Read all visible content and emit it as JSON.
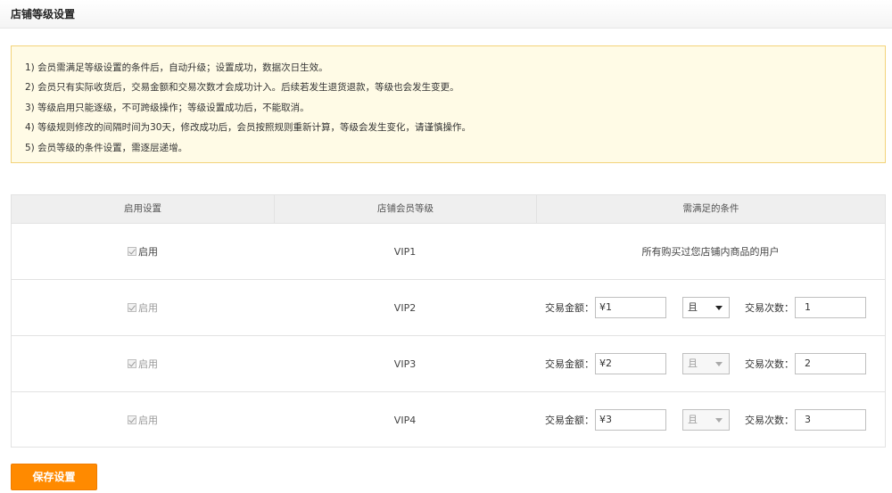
{
  "header": {
    "title": "店铺等级设置"
  },
  "notice": {
    "lines": [
      "1) 会员需满足等级设置的条件后，自动升级；设置成功，数据次日生效。",
      "2) 会员只有实际收货后，交易金额和交易次数才会成功计入。后续若发生退货退款，等级也会发生变更。",
      "3) 等级启用只能逐级，不可跨级操作；等级设置成功后，不能取消。",
      "4) 等级规则修改的间隔时间为30天，修改成功后，会员按照规则重新计算，等级会发生变化，请谨慎操作。",
      "5) 会员等级的条件设置，需逐层递增。"
    ]
  },
  "table": {
    "headers": [
      "启用设置",
      "店铺会员等级",
      "需满足的条件"
    ],
    "rows": [
      {
        "enable_label": "启用",
        "checked": true,
        "level": "VIP1",
        "condition_text": "所有购买过您店铺内商品的用户"
      },
      {
        "enable_label": "启用",
        "checked": true,
        "level": "VIP2",
        "amount_label": "交易金额：",
        "amount": "¥1",
        "logic": "且",
        "count_label": "交易次数：",
        "count": "1"
      },
      {
        "enable_label": "启用",
        "checked": true,
        "level": "VIP3",
        "amount_label": "交易金额：",
        "amount": "¥2",
        "logic": "且",
        "count_label": "交易次数：",
        "count": "2"
      },
      {
        "enable_label": "启用",
        "checked": true,
        "level": "VIP4",
        "amount_label": "交易金额：",
        "amount": "¥3",
        "logic": "且",
        "count_label": "交易次数：",
        "count": "3"
      }
    ]
  },
  "actions": {
    "save_label": "保存设置"
  },
  "colors": {
    "accent": "#ff8a00",
    "notice_bg": "#fffbe6",
    "notice_border": "#f3d37a"
  }
}
